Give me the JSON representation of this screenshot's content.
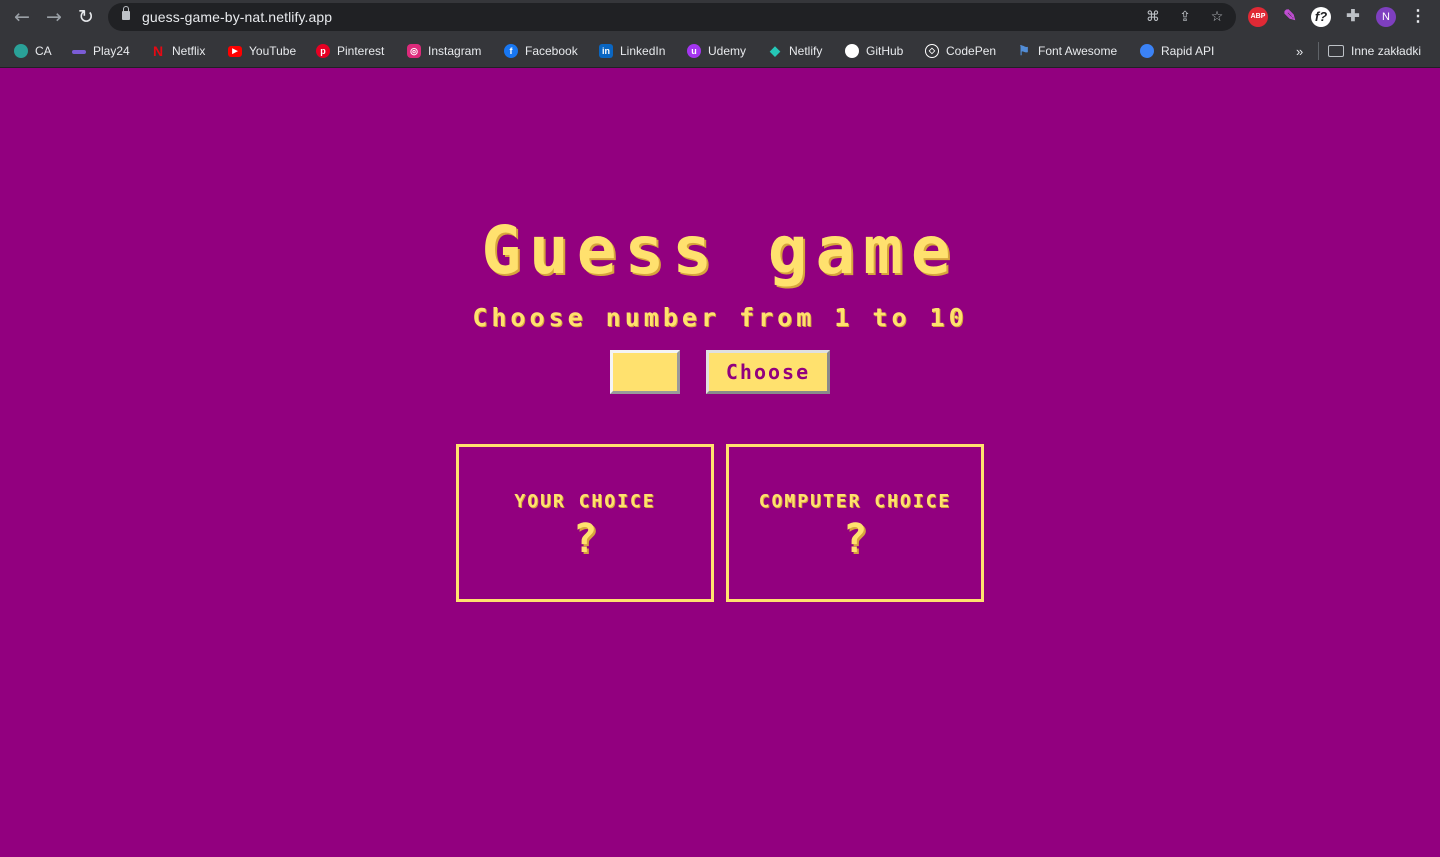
{
  "browser": {
    "url": "guess-game-by-nat.netlify.app",
    "bookmarks": [
      {
        "label": "CA",
        "icon": "ca-icon",
        "color": "#2aa198"
      },
      {
        "label": "Play24",
        "icon": "play24-icon",
        "color": "#7b5cd6"
      },
      {
        "label": "Netflix",
        "icon": "netflix-icon",
        "color": "#e50914"
      },
      {
        "label": "YouTube",
        "icon": "youtube-icon",
        "color": "#ff0000"
      },
      {
        "label": "Pinterest",
        "icon": "pinterest-icon",
        "color": "#e60023"
      },
      {
        "label": "Instagram",
        "icon": "instagram-icon",
        "color": "#dd2a7b"
      },
      {
        "label": "Facebook",
        "icon": "facebook-icon",
        "color": "#1877f2"
      },
      {
        "label": "LinkedIn",
        "icon": "linkedin-icon",
        "color": "#0a66c2"
      },
      {
        "label": "Udemy",
        "icon": "udemy-icon",
        "color": "#a435f0"
      },
      {
        "label": "Netlify",
        "icon": "netlify-icon",
        "color": "#25c7b7"
      },
      {
        "label": "GitHub",
        "icon": "github-icon",
        "color": "#ffffff"
      },
      {
        "label": "CodePen",
        "icon": "codepen-icon",
        "color": "#ffffff"
      },
      {
        "label": "Font Awesome",
        "icon": "font-awesome-icon",
        "color": "#528dd7"
      },
      {
        "label": "Rapid API",
        "icon": "rapid-api-icon",
        "color": "#3b82f6"
      }
    ],
    "overflow_label": "»",
    "other_bookmarks_label": "Inne zakładki",
    "profile_initial": "N",
    "abp_label": "ABP",
    "font_ext_label": "f?"
  },
  "game": {
    "title": "Guess game",
    "subtitle": "Choose number from 1 to 10",
    "input_value": "",
    "choose_button": "Choose",
    "your_choice_label": "YOUR CHOICE",
    "your_choice_value": "?",
    "computer_choice_label": "COMPUTER CHOICE",
    "computer_choice_value": "?"
  },
  "colors": {
    "background": "#92007f",
    "accent": "#ffe16e"
  }
}
